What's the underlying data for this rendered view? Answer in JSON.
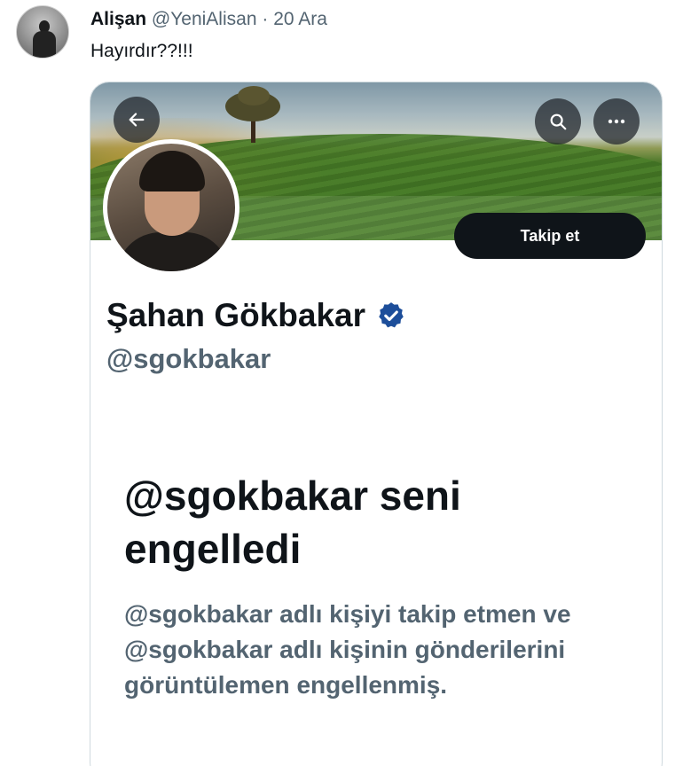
{
  "tweet": {
    "name": "Alişan",
    "handle": "@YeniAlisan",
    "separator": "·",
    "date": "20 Ara",
    "text": "Hayırdır??!!!"
  },
  "profile_card": {
    "nav": {
      "back_icon": "arrow-left-icon",
      "search_icon": "search-icon",
      "more_icon": "more-horizontal-icon"
    },
    "follow_label": "Takip et",
    "display_name": "Şahan Gökbakar",
    "verified_icon": "verified-badge-icon",
    "handle": "@sgokbakar",
    "blocked_title": "@sgokbakar seni engelledi",
    "blocked_description": "@sgokbakar adlı kişiyi takip etmen ve @sgokbakar adlı kişinin gönderilerini görüntülemen engellenmiş."
  },
  "colors": {
    "primary_text": "#0f1419",
    "secondary_text": "#536471",
    "verified_blue": "#1d9bf0",
    "follow_button_bg": "#0f1419"
  }
}
